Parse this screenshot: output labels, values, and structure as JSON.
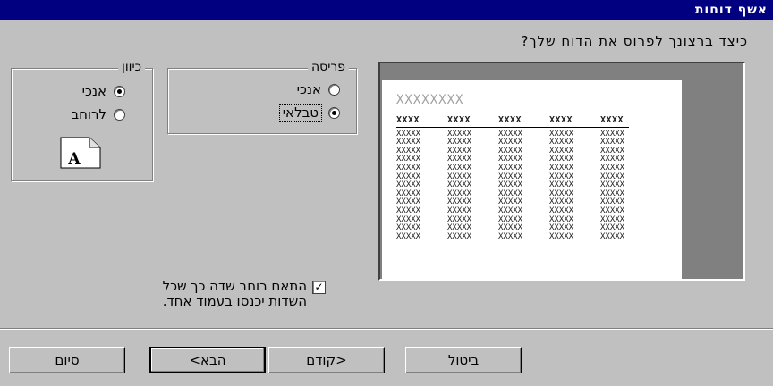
{
  "window": {
    "title": "אשף דוחות"
  },
  "question": "כיצד ברצונך לפרוס את הדוח שלך?",
  "layout_group": {
    "legend": "פריסה",
    "options": [
      {
        "label": "אנכי",
        "selected": false
      },
      {
        "label": "טבלאי",
        "selected": true
      }
    ]
  },
  "orientation_group": {
    "legend": "כיוון",
    "options": [
      {
        "label": "אנכי",
        "selected": true
      },
      {
        "label": "לרוחב",
        "selected": false
      }
    ],
    "page_icon_letter": "A"
  },
  "preview": {
    "title_placeholder": "XXXXXXXX",
    "header_cells": [
      "XXXX",
      "XXXX",
      "XXXX",
      "XXXX",
      "XXXX"
    ],
    "row_cell": "XXXXX",
    "row_count": 13
  },
  "fit_checkbox": {
    "checked": true,
    "label_line1": "התאם רוחב שדה כך שכל",
    "label_line2": "השדות יכנסו בעמוד אחד."
  },
  "buttons": {
    "cancel": "ביטול",
    "back": "<קודם",
    "next": "הבא>",
    "finish": "סיום"
  }
}
